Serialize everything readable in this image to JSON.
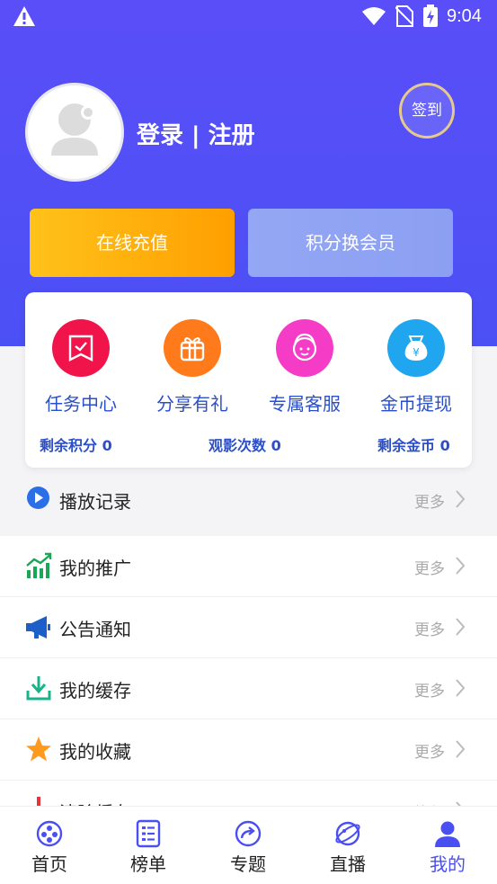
{
  "status_bar": {
    "time": "9:04",
    "icons": [
      "warning-icon",
      "wifi-icon",
      "no-sim-icon",
      "battery-charging-icon"
    ]
  },
  "header": {
    "login_register": "登录 | 注册",
    "signin_label": "签到"
  },
  "actions": {
    "recharge": "在线充值",
    "points_exchange": "积分换会员"
  },
  "features": [
    {
      "label": "任务中心",
      "icon": "task-icon",
      "color": "#f0144a"
    },
    {
      "label": "分享有礼",
      "icon": "gift-icon",
      "color": "#ff7a1a"
    },
    {
      "label": "专属客服",
      "icon": "customer-service-icon",
      "color": "#f53cc7"
    },
    {
      "label": "金币提现",
      "icon": "money-bag-icon",
      "color": "#1fa6ee"
    }
  ],
  "stats": {
    "points": "剩余积分 0",
    "views": "观影次数 0",
    "coins": "剩余金币 0"
  },
  "play_record": {
    "label": "播放记录",
    "more": "更多"
  },
  "menu": [
    {
      "label": "我的推广",
      "more": "更多",
      "icon": "chart-icon"
    },
    {
      "label": "公告通知",
      "more": "更多",
      "icon": "megaphone-icon"
    },
    {
      "label": "我的缓存",
      "more": "更多",
      "icon": "download-icon"
    },
    {
      "label": "我的收藏",
      "more": "更多",
      "icon": "star-icon"
    },
    {
      "label": "清除缓存",
      "more": "执行",
      "icon": "clear-icon"
    }
  ],
  "tabs": [
    {
      "label": "首页",
      "icon": "home-icon"
    },
    {
      "label": "榜单",
      "icon": "ranking-icon"
    },
    {
      "label": "专题",
      "icon": "topic-icon"
    },
    {
      "label": "直播",
      "icon": "live-icon"
    },
    {
      "label": "我的",
      "icon": "profile-icon",
      "active": true
    }
  ],
  "colors": {
    "primary": "#4b50f5",
    "accent_blue": "#2a4fc8",
    "orange": "#ff9f00"
  }
}
